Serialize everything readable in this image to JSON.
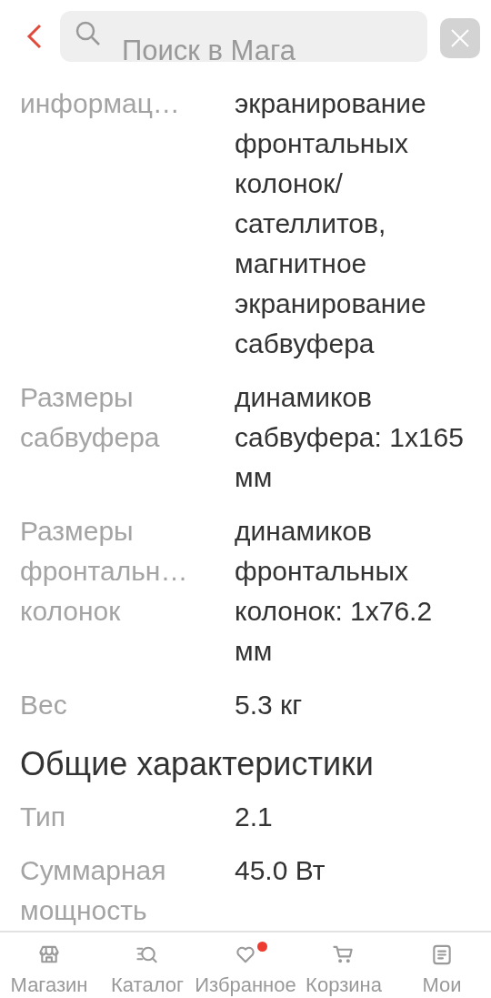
{
  "header": {
    "search": {
      "placeholder": "Поиск в Мага"
    }
  },
  "specs": [
    {
      "kind": "row",
      "label": "информац…",
      "value": "экранирование фронтальных колонок/ сателлитов, магнитное экранирование сабвуфера"
    },
    {
      "kind": "row",
      "label": "Размеры сабвуфера",
      "value": "динамиков сабвуфера: 1x165 мм"
    },
    {
      "kind": "row",
      "label": "Размеры фронтальн… колонок",
      "value": "динамиков фронтальных колонок: 1x76.2 мм"
    },
    {
      "kind": "row",
      "label": "Вес",
      "value": "5.3 кг"
    },
    {
      "kind": "heading",
      "label": "Общие характеристики"
    },
    {
      "kind": "row",
      "label": "Тип",
      "value": "2.1"
    },
    {
      "kind": "row",
      "label": "Суммарная мощность",
      "value": "45.0 Вт"
    }
  ],
  "nav": [
    {
      "kind": "store",
      "label": "Магазин",
      "badge": false
    },
    {
      "kind": "catalog",
      "label": "Каталог",
      "badge": false
    },
    {
      "kind": "heart",
      "label": "Избранное",
      "badge": true
    },
    {
      "kind": "cart",
      "label": "Корзина",
      "badge": false
    },
    {
      "kind": "list",
      "label": "Мои",
      "badge": false
    }
  ]
}
